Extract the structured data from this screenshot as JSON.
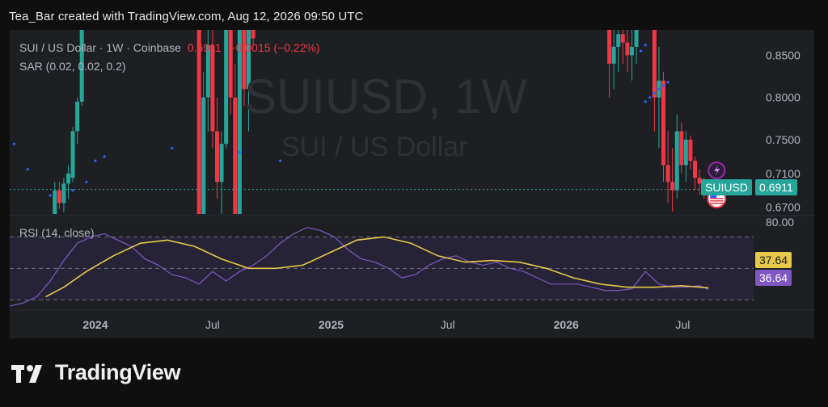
{
  "header": {
    "text": "Tea_Bar created with TradingView.com, Aug 12, 2026 09:50 UTC"
  },
  "legend": {
    "line1_prefix": "SUI / US Dollar · 1W · Coinbase",
    "last_price": "0.6911",
    "change": "−0.0015 (−0.22%)",
    "line2": "SAR (0.02, 0.02, 0.2)"
  },
  "watermark": {
    "symbol": "SUIUSD, 1W",
    "name": "SUI / US Dollar"
  },
  "symbol_label": "SUIUSD",
  "rsi_label": "RSI (14, close)",
  "logo_text": "TradingView",
  "colors": {
    "up": "#26a69a",
    "down": "#f23645",
    "sar": "#2962ff",
    "rsi_line": "#7e57c2",
    "rsi_ma": "#e6c84a",
    "price_line": "#26a69a",
    "rsi_band": "#2a2540"
  },
  "chart_data": [
    {
      "type": "candlestick",
      "title": "SUI / US Dollar · 1W · Coinbase",
      "y_ticks": [
        0.85,
        0.8,
        0.75,
        0.71,
        0.67
      ],
      "y_tick_labels": [
        "0.8500",
        "0.8000",
        "0.7500",
        "0.7100",
        "0.6700"
      ],
      "ylim": [
        0.662,
        0.88
      ],
      "x_ticks": [
        "2024",
        "Jul",
        "2025",
        "Jul",
        "2026",
        "Jul"
      ],
      "x_tick_dates": [
        "2024-01-01",
        "2024-07-01",
        "2025-01-01",
        "2025-07-01",
        "2026-01-01",
        "2026-07-01"
      ],
      "xlim": [
        "2023-08-21",
        "2026-10-19"
      ],
      "current_price": 0.6911,
      "current_price_label": "0.6911",
      "candles": [
        {
          "d": "2023-10-30",
          "o": 0.66,
          "h": 0.7,
          "l": 0.655,
          "c": 0.69
        },
        {
          "d": "2023-11-06",
          "o": 0.69,
          "h": 0.7,
          "l": 0.668,
          "c": 0.675
        },
        {
          "d": "2023-11-13",
          "o": 0.675,
          "h": 0.705,
          "l": 0.664,
          "c": 0.698
        },
        {
          "d": "2023-11-20",
          "o": 0.698,
          "h": 0.72,
          "l": 0.68,
          "c": 0.71
        },
        {
          "d": "2023-11-27",
          "o": 0.705,
          "h": 0.765,
          "l": 0.7,
          "c": 0.76
        },
        {
          "d": "2023-12-04",
          "o": 0.76,
          "h": 0.8,
          "l": 0.745,
          "c": 0.795
        },
        {
          "d": "2023-12-11",
          "o": 0.795,
          "h": 0.88,
          "l": 0.79,
          "c": 0.88
        },
        {
          "d": "2024-06-10",
          "o": 0.88,
          "h": 0.88,
          "l": 0.662,
          "c": 0.662
        },
        {
          "d": "2024-06-17",
          "o": 0.662,
          "h": 0.83,
          "l": 0.662,
          "c": 0.8
        },
        {
          "d": "2024-06-24",
          "o": 0.8,
          "h": 0.88,
          "l": 0.76,
          "c": 0.862
        },
        {
          "d": "2024-07-01",
          "o": 0.862,
          "h": 0.88,
          "l": 0.74,
          "c": 0.76
        },
        {
          "d": "2024-07-08",
          "o": 0.76,
          "h": 0.8,
          "l": 0.68,
          "c": 0.7
        },
        {
          "d": "2024-07-15",
          "o": 0.7,
          "h": 0.76,
          "l": 0.662,
          "c": 0.745
        },
        {
          "d": "2024-07-22",
          "o": 0.745,
          "h": 0.88,
          "l": 0.74,
          "c": 0.88
        },
        {
          "d": "2024-07-29",
          "o": 0.88,
          "h": 0.88,
          "l": 0.78,
          "c": 0.8
        },
        {
          "d": "2024-08-05",
          "o": 0.8,
          "h": 0.84,
          "l": 0.662,
          "c": 0.662
        },
        {
          "d": "2024-08-12",
          "o": 0.662,
          "h": 0.88,
          "l": 0.662,
          "c": 0.88
        },
        {
          "d": "2024-08-19",
          "o": 0.88,
          "h": 0.88,
          "l": 0.79,
          "c": 0.81
        },
        {
          "d": "2024-08-26",
          "o": 0.81,
          "h": 0.88,
          "l": 0.76,
          "c": 0.88
        },
        {
          "d": "2024-09-02",
          "o": 0.88,
          "h": 0.88,
          "l": 0.86,
          "c": 0.87
        },
        {
          "d": "2026-03-09",
          "o": 0.88,
          "h": 0.88,
          "l": 0.8,
          "c": 0.84
        },
        {
          "d": "2026-03-16",
          "o": 0.84,
          "h": 0.88,
          "l": 0.81,
          "c": 0.86
        },
        {
          "d": "2026-03-23",
          "o": 0.86,
          "h": 0.88,
          "l": 0.83,
          "c": 0.875
        },
        {
          "d": "2026-03-30",
          "o": 0.875,
          "h": 0.88,
          "l": 0.84,
          "c": 0.865
        },
        {
          "d": "2026-04-06",
          "o": 0.865,
          "h": 0.88,
          "l": 0.83,
          "c": 0.85
        },
        {
          "d": "2026-04-13",
          "o": 0.85,
          "h": 0.88,
          "l": 0.82,
          "c": 0.86
        },
        {
          "d": "2026-04-20",
          "o": 0.86,
          "h": 0.88,
          "l": 0.84,
          "c": 0.88
        },
        {
          "d": "2026-05-18",
          "o": 0.88,
          "h": 0.88,
          "l": 0.76,
          "c": 0.8
        },
        {
          "d": "2026-05-25",
          "o": 0.8,
          "h": 0.86,
          "l": 0.74,
          "c": 0.82
        },
        {
          "d": "2026-06-01",
          "o": 0.82,
          "h": 0.83,
          "l": 0.7,
          "c": 0.72
        },
        {
          "d": "2026-06-08",
          "o": 0.72,
          "h": 0.76,
          "l": 0.675,
          "c": 0.7
        },
        {
          "d": "2026-06-15",
          "o": 0.7,
          "h": 0.74,
          "l": 0.665,
          "c": 0.69
        },
        {
          "d": "2026-06-22",
          "o": 0.69,
          "h": 0.78,
          "l": 0.68,
          "c": 0.76
        },
        {
          "d": "2026-06-29",
          "o": 0.76,
          "h": 0.77,
          "l": 0.71,
          "c": 0.72
        },
        {
          "d": "2026-07-06",
          "o": 0.72,
          "h": 0.76,
          "l": 0.7,
          "c": 0.75
        },
        {
          "d": "2026-07-13",
          "o": 0.75,
          "h": 0.755,
          "l": 0.715,
          "c": 0.725
        },
        {
          "d": "2026-07-20",
          "o": 0.725,
          "h": 0.73,
          "l": 0.69,
          "c": 0.705
        },
        {
          "d": "2026-07-27",
          "o": 0.705,
          "h": 0.715,
          "l": 0.685,
          "c": 0.698
        },
        {
          "d": "2026-08-03",
          "o": 0.698,
          "h": 0.705,
          "l": 0.68,
          "c": 0.6926
        },
        {
          "d": "2026-08-10",
          "o": 0.6926,
          "h": 0.7,
          "l": 0.684,
          "c": 0.6911
        }
      ],
      "sar": [
        {
          "d": "2023-08-28",
          "v": 0.745
        },
        {
          "d": "2023-09-18",
          "v": 0.715
        },
        {
          "d": "2023-10-23",
          "v": 0.684
        },
        {
          "d": "2023-11-27",
          "v": 0.69
        },
        {
          "d": "2023-12-18",
          "v": 0.7
        },
        {
          "d": "2024-01-01",
          "v": 0.725
        },
        {
          "d": "2024-01-15",
          "v": 0.73
        },
        {
          "d": "2024-04-29",
          "v": 0.74
        },
        {
          "d": "2024-08-12",
          "v": 0.735
        },
        {
          "d": "2024-10-14",
          "v": 0.725
        },
        {
          "d": "2026-05-04",
          "v": 0.795
        },
        {
          "d": "2026-05-11",
          "v": 0.8
        },
        {
          "d": "2026-05-18",
          "v": 0.805
        },
        {
          "d": "2026-05-25",
          "v": 0.81
        },
        {
          "d": "2026-06-01",
          "v": 0.814
        },
        {
          "d": "2026-06-08",
          "v": 0.818
        },
        {
          "d": "2026-04-27",
          "v": 0.855
        },
        {
          "d": "2026-05-04",
          "v": 0.862
        }
      ]
    },
    {
      "type": "line",
      "title": "RSI (14, close)",
      "ylim": [
        24,
        82
      ],
      "y_tick_labels": [
        "80.00"
      ],
      "bands": [
        70,
        50,
        30
      ],
      "rsi_last": 36.64,
      "ma_last": 37.64,
      "rsi_last_label": "36.64",
      "ma_last_label": "37.64",
      "x": [
        "2023-08-21",
        "2023-09-11",
        "2023-10-02",
        "2023-10-23",
        "2023-11-13",
        "2023-12-04",
        "2023-12-25",
        "2024-01-15",
        "2024-02-05",
        "2024-02-26",
        "2024-03-18",
        "2024-04-08",
        "2024-04-29",
        "2024-05-20",
        "2024-06-10",
        "2024-07-01",
        "2024-07-22",
        "2024-08-12",
        "2024-09-02",
        "2024-09-23",
        "2024-10-14",
        "2024-11-04",
        "2024-11-25",
        "2024-12-16",
        "2025-01-06",
        "2025-01-27",
        "2025-02-17",
        "2025-03-10",
        "2025-03-31",
        "2025-04-21",
        "2025-05-12",
        "2025-06-02",
        "2025-06-23",
        "2025-07-14",
        "2025-08-04",
        "2025-08-25",
        "2025-09-15",
        "2025-10-06",
        "2025-10-27",
        "2025-11-17",
        "2025-12-08",
        "2025-12-29",
        "2026-01-19",
        "2026-02-09",
        "2026-03-02",
        "2026-03-23",
        "2026-04-13",
        "2026-05-04",
        "2026-05-25",
        "2026-06-15",
        "2026-07-06",
        "2026-07-27",
        "2026-08-10"
      ],
      "series": [
        {
          "name": "RSI",
          "values": [
            26,
            28,
            32,
            42,
            55,
            66,
            70,
            72,
            68,
            64,
            56,
            52,
            46,
            44,
            40,
            48,
            42,
            48,
            52,
            58,
            66,
            72,
            76,
            74,
            70,
            62,
            56,
            54,
            50,
            44,
            46,
            52,
            56,
            58,
            54,
            52,
            54,
            50,
            48,
            44,
            40,
            40,
            40,
            38,
            36,
            36,
            37,
            48,
            40,
            38,
            38,
            39,
            36.64
          ]
        },
        {
          "name": "RSI-based MA",
          "values": [
            null,
            null,
            null,
            null,
            null,
            null,
            null,
            null,
            null,
            null,
            null,
            null,
            null,
            null,
            null,
            null,
            null,
            null,
            null,
            null,
            null,
            null,
            null,
            null,
            null,
            null,
            null,
            null,
            null,
            null,
            null,
            null,
            null,
            null,
            null,
            null,
            null,
            null,
            null,
            null,
            null,
            null,
            null,
            null,
            null,
            null,
            null,
            null,
            null,
            null,
            null,
            null,
            37.64
          ]
        }
      ],
      "ma_points": {
        "x": [
          "2023-10-16",
          "2023-11-13",
          "2023-12-18",
          "2024-01-29",
          "2024-03-11",
          "2024-04-22",
          "2024-06-03",
          "2024-07-15",
          "2024-08-26",
          "2024-10-07",
          "2024-11-18",
          "2024-12-30",
          "2025-02-10",
          "2025-03-24",
          "2025-05-05",
          "2025-06-16",
          "2025-07-28",
          "2025-09-08",
          "2025-10-20",
          "2025-12-01",
          "2026-01-12",
          "2026-02-23",
          "2026-04-06",
          "2026-05-18",
          "2026-06-29",
          "2026-08-10"
        ],
        "values": [
          32,
          38,
          48,
          58,
          66,
          68,
          64,
          56,
          50,
          50,
          52,
          60,
          68,
          70,
          66,
          58,
          54,
          55,
          54,
          50,
          44,
          40,
          38,
          38,
          39,
          37.64
        ]
      }
    }
  ]
}
